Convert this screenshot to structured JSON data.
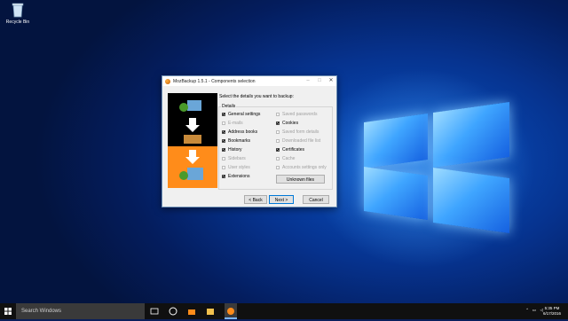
{
  "desktop": {
    "icons": [
      {
        "label": "Recycle Bin",
        "icon": "recycle-bin-icon"
      }
    ]
  },
  "dialog": {
    "title": "MozBackup 1.5.1 - Components selection",
    "prompt": "Select the details you want to backup:",
    "group_label": "Details",
    "left_items": [
      {
        "label": "General settings",
        "checked": true,
        "enabled": true
      },
      {
        "label": "E-mails",
        "checked": false,
        "enabled": false
      },
      {
        "label": "Address books",
        "checked": true,
        "enabled": true
      },
      {
        "label": "Bookmarks",
        "checked": true,
        "enabled": true
      },
      {
        "label": "History",
        "checked": true,
        "enabled": true
      },
      {
        "label": "Sidebars",
        "checked": false,
        "enabled": false
      },
      {
        "label": "User styles",
        "checked": false,
        "enabled": false
      },
      {
        "label": "Extensions",
        "checked": true,
        "enabled": true
      }
    ],
    "right_items": [
      {
        "label": "Saved passwords",
        "checked": false,
        "enabled": false
      },
      {
        "label": "Cookies",
        "checked": true,
        "enabled": true
      },
      {
        "label": "Saved form details",
        "checked": false,
        "enabled": false
      },
      {
        "label": "Downloaded file list",
        "checked": false,
        "enabled": false
      },
      {
        "label": "Certificates",
        "checked": true,
        "enabled": true
      },
      {
        "label": "Cache",
        "checked": false,
        "enabled": false
      },
      {
        "label": "Accounts settings only",
        "checked": false,
        "enabled": false
      }
    ],
    "unknown_files_label": "Unknown files",
    "back_label": "< Back",
    "next_label": "Next >",
    "cancel_label": "Cancel"
  },
  "taskbar": {
    "search_placeholder": "Search Windows",
    "clock_time": "5:35 PM",
    "clock_date": "6/17/2016"
  }
}
